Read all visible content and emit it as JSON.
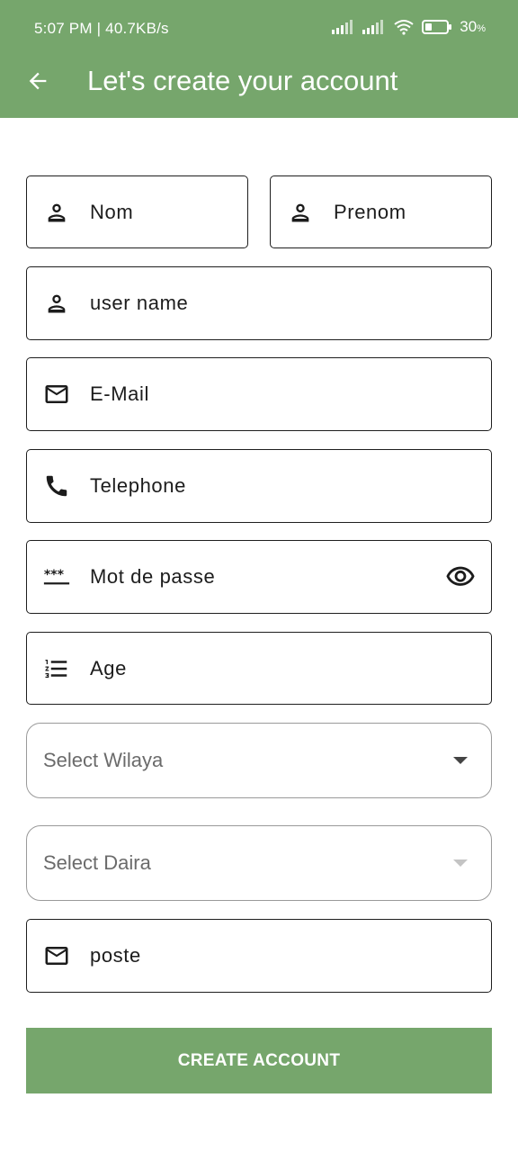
{
  "status_bar": {
    "time": "5:07 PM | 40.7KB/s",
    "battery_value": "30",
    "battery_unit": "%",
    "icons": [
      "signal-icon",
      "signal-icon",
      "wifi-icon",
      "battery-icon"
    ]
  },
  "app_bar": {
    "title": "Let's create your account",
    "back_icon": "arrow-back-icon",
    "color": "#76a66c"
  },
  "form": {
    "nom": {
      "label": "Nom",
      "icon": "person-icon"
    },
    "prenom": {
      "label": "Prenom",
      "icon": "person-icon"
    },
    "username": {
      "label": "user name",
      "icon": "person-icon"
    },
    "email": {
      "label": "E-Mail",
      "icon": "mail-icon"
    },
    "telephone": {
      "label": "Telephone",
      "icon": "phone-icon"
    },
    "password": {
      "label": "Mot de passe",
      "icon": "password-icon",
      "toggle_icon": "eye-icon"
    },
    "age": {
      "label": "Age",
      "icon": "numbered-list-icon"
    },
    "wilaya": {
      "placeholder": "Select Wilaya",
      "icon": "dropdown-arrow-icon"
    },
    "daira": {
      "placeholder": "Select Daira",
      "icon": "dropdown-arrow-icon",
      "disabled": true
    },
    "poste": {
      "label": "poste",
      "icon": "mail-icon"
    }
  },
  "actions": {
    "create_label": "CREATE ACCOUNT"
  }
}
